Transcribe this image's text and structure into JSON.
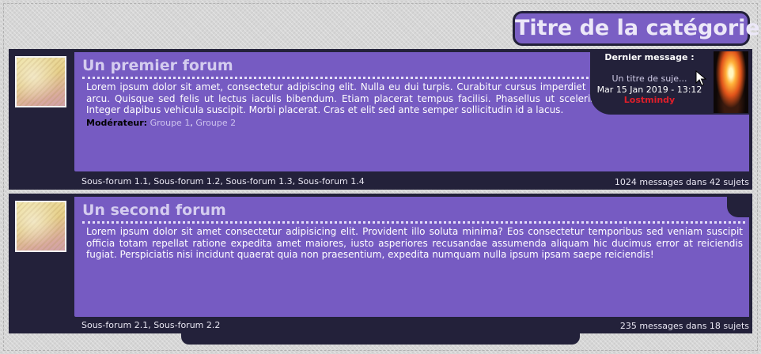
{
  "category": {
    "title": "Titre de la catégorie"
  },
  "forums": [
    {
      "title": "Un premier forum",
      "description": "Lorem ipsum dolor sit amet, consectetur adipiscing elit. Nulla eu dui turpis. Curabitur cursus imperdiet aliquam vitae. Nunc non ornare arcu. Quisque sed felis ut lectus iaculis bibendum. Etiam placerat tempus facilisi. Phasellus ut scelerisque sem. Sed vel viverra elit. Integer dapibus vehicula suscipit. Morbi placerat. Cras et elit sed ante semper sollicitudin id a lacus.",
      "moderators_label": "Modérateur:",
      "moderators": [
        "Groupe 1",
        "Groupe 2"
      ],
      "subforums": [
        "Sous-forum 1.1",
        "Sous-forum 1.2",
        "Sous-forum 1.3",
        "Sous-forum 1.4"
      ],
      "stats": "1024 messages dans 42 sujets",
      "last_post": {
        "heading": "Dernier message :",
        "topic": "Un titre de suje...",
        "date": "Mar 15 Jan 2019 - 13:12",
        "user": "Lostmindy"
      }
    },
    {
      "title": "Un second forum",
      "description": "Lorem ipsum dolor sit amet consectetur adipisicing elit. Provident illo soluta minima? Eos consectetur temporibus sed veniam suscipit officia totam repellat ratione expedita amet maiores, iusto asperiores recusandae assumenda aliquam hic ducimus error at reiciendis fugiat. Perspiciatis nisi incidunt quaerat quia non praesentium, expedita numquam nulla ipsum ipsam saepe reiciendis!",
      "subforums": [
        "Sous-forum 2.1",
        "Sous-forum 2.2"
      ],
      "stats": "235 messages dans 18 sujets"
    }
  ],
  "colors": {
    "panel": "#765bc2",
    "dark": "#23213a",
    "title_text": "#d4ccef",
    "username": "#e01e2a"
  },
  "icons": [
    "forum-image-icon",
    "avatar",
    "mouse-cursor-icon"
  ]
}
